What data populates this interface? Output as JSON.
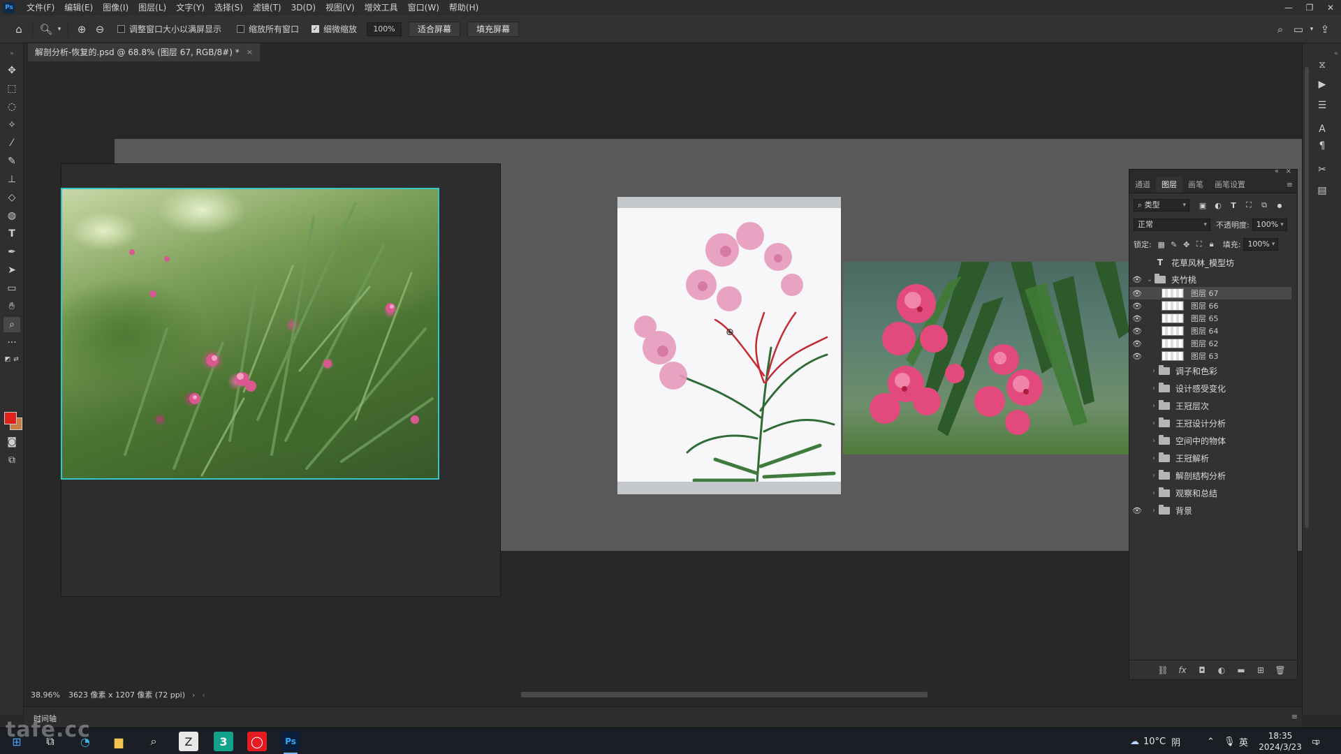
{
  "app": {
    "logo": "Ps",
    "menu": [
      "文件(F)",
      "编辑(E)",
      "图像(I)",
      "图层(L)",
      "文字(Y)",
      "选择(S)",
      "滤镜(T)",
      "3D(D)",
      "视图(V)",
      "增效工具",
      "窗口(W)",
      "帮助(H)"
    ],
    "window_controls": [
      "—",
      "❐",
      "✕"
    ]
  },
  "options_bar": {
    "resize_windows_label": "调整窗口大小以满屏显示",
    "resize_windows_checked": false,
    "zoom_all_label": "缩放所有窗口",
    "zoom_all_checked": false,
    "scrubby_zoom_label": "细微缩放",
    "scrubby_zoom_checked": true,
    "zoom_value": "100%",
    "fit_screen_label": "适合屏幕",
    "fill_screen_label": "填充屏幕"
  },
  "document": {
    "tab_title": "解剖分析-恢复的.psd @ 68.8% (图层 67, RGB/8#) *",
    "close": "×"
  },
  "layers_panel": {
    "tabs": [
      "通道",
      "图层",
      "画笔",
      "画笔设置"
    ],
    "active_tab": "图层",
    "filter_kind": "类型",
    "blend_mode": "正常",
    "opacity_label": "不透明度:",
    "opacity_value": "100%",
    "lock_label": "锁定:",
    "fill_label": "填充:",
    "fill_value": "100%",
    "layers": [
      {
        "name": "花草风林_模型坊",
        "type": "text",
        "visible": false,
        "indent": 0
      },
      {
        "name": "夹竹桃",
        "type": "group-open",
        "visible": true,
        "indent": 0
      },
      {
        "name": "图层 67",
        "type": "pixel",
        "visible": true,
        "indent": 1,
        "selected": true
      },
      {
        "name": "图层 66",
        "type": "pixel",
        "visible": true,
        "indent": 1
      },
      {
        "name": "图层 65",
        "type": "pixel",
        "visible": true,
        "indent": 1
      },
      {
        "name": "图层 64",
        "type": "pixel",
        "visible": true,
        "indent": 1
      },
      {
        "name": "图层 62",
        "type": "pixel",
        "visible": true,
        "indent": 1
      },
      {
        "name": "图层 63",
        "type": "pixel",
        "visible": true,
        "indent": 1
      },
      {
        "name": "调子和色彩",
        "type": "group",
        "visible": false,
        "indent": 0
      },
      {
        "name": "设计感受变化",
        "type": "group",
        "visible": false,
        "indent": 0
      },
      {
        "name": "王冠层次",
        "type": "group",
        "visible": false,
        "indent": 0
      },
      {
        "name": "王冠设计分析",
        "type": "group",
        "visible": false,
        "indent": 0
      },
      {
        "name": "空间中的物体",
        "type": "group",
        "visible": false,
        "indent": 0
      },
      {
        "name": "王冠解析",
        "type": "group",
        "visible": false,
        "indent": 0
      },
      {
        "name": "解剖结构分析",
        "type": "group",
        "visible": false,
        "indent": 0
      },
      {
        "name": "观察和总结",
        "type": "group",
        "visible": false,
        "indent": 0
      },
      {
        "name": "背景",
        "type": "group",
        "visible": true,
        "indent": 0
      }
    ],
    "bottom_icons": [
      "link-icon",
      "fx-icon",
      "mask-icon",
      "adjustment-icon",
      "new-group-icon",
      "new-layer-icon",
      "delete-icon"
    ]
  },
  "status": {
    "zoom": "38.96%",
    "doc_info": "3623 像素 x 1207 像素 (72 ppi)"
  },
  "timeline": {
    "label": "时间轴"
  },
  "taskbar": {
    "weather_temp": "10°C",
    "weather_text": "阴",
    "ime": "英",
    "time": "18:35",
    "date": "2024/3/23",
    "notification_count": "1"
  },
  "watermark": "tafe.cc",
  "colors": {
    "foreground": "#e0201b",
    "background": "#c67e42",
    "selection": "#35c6c6"
  }
}
